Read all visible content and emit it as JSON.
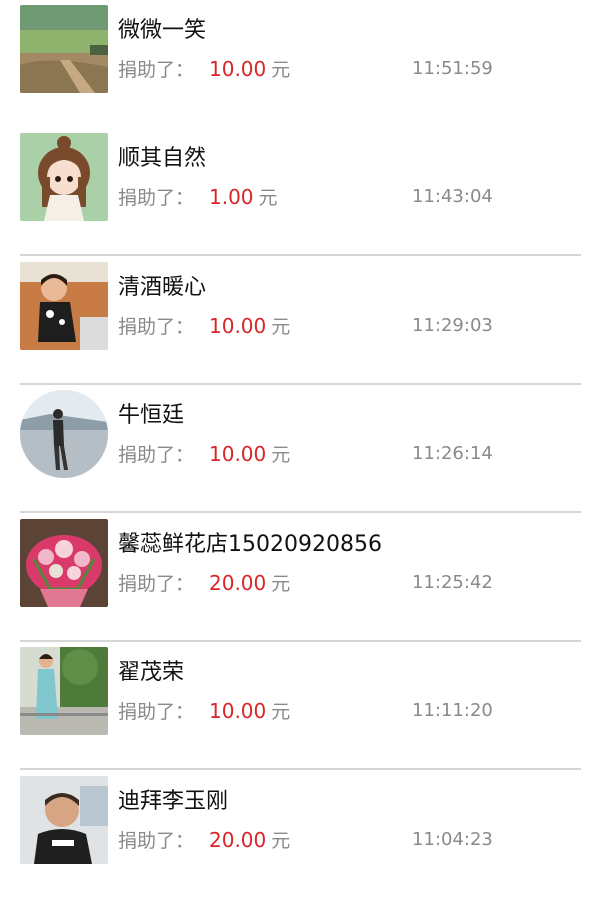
{
  "donors": [
    {
      "name": "微微一笑",
      "label": "捐助了：",
      "amount": "10.00",
      "unit": "元",
      "time": "11:51:59",
      "avatar": "landscape-photo"
    },
    {
      "name": "顺其自然",
      "label": "捐助了：",
      "amount": "1.00",
      "unit": "元",
      "time": "11:43:04",
      "avatar": "cartoon-girl"
    },
    {
      "name": "清酒暖心",
      "label": "捐助了：",
      "amount": "10.00",
      "unit": "元",
      "time": "11:29:03",
      "avatar": "child-photo"
    },
    {
      "name": "牛恒廷",
      "label": "捐助了：",
      "amount": "10.00",
      "unit": "元",
      "time": "11:26:14",
      "avatar": "person-on-beach"
    },
    {
      "name": "馨蕊鲜花店15020920856",
      "label": "捐助了：",
      "amount": "20.00",
      "unit": "元",
      "time": "11:25:42",
      "avatar": "flower-bouquet"
    },
    {
      "name": "翟茂荣",
      "label": "捐助了：",
      "amount": "10.00",
      "unit": "元",
      "time": "11:11:20",
      "avatar": "woman-outdoors"
    },
    {
      "name": "迪拜李玉刚",
      "label": "捐助了：",
      "amount": "20.00",
      "unit": "元",
      "time": "11:04:23",
      "avatar": "man-portrait"
    }
  ]
}
